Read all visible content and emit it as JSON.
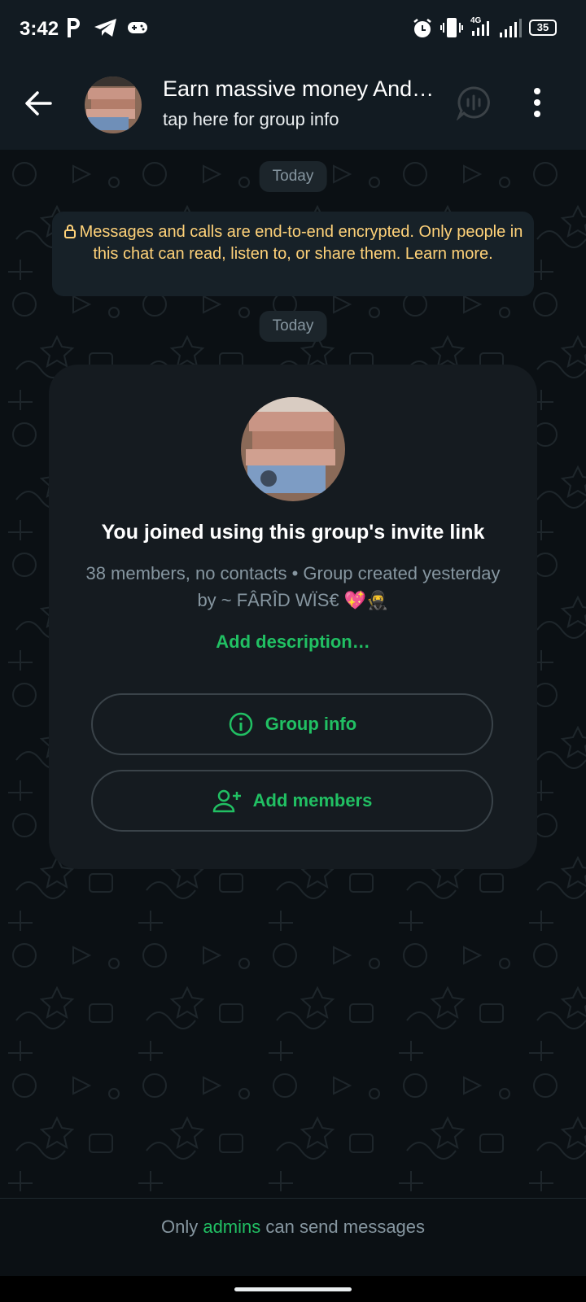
{
  "status_bar": {
    "time": "3:42",
    "network": "4G",
    "battery": "35"
  },
  "header": {
    "title": "Earn massive money And…",
    "subtitle": "tap here for group info"
  },
  "chat": {
    "date_1": "Today",
    "encryption": "Messages and calls are end-to-end encrypted. Only people in this chat can read, listen to, or share them. Learn more.",
    "date_2": "Today"
  },
  "card": {
    "joined": "You joined using this group's invite link",
    "meta": "38 members, no contacts • Group created yesterday by ~ FÂRÎD WÏS€ 💖🥷",
    "add_description": "Add description…",
    "group_info_label": "Group info",
    "add_members_label": "Add members"
  },
  "footer": {
    "prefix": "Only ",
    "admins": "admins",
    "suffix": " can send messages"
  },
  "colors": {
    "accent": "#21c063",
    "encryption_text": "#ffd279",
    "background": "#0b1014"
  }
}
